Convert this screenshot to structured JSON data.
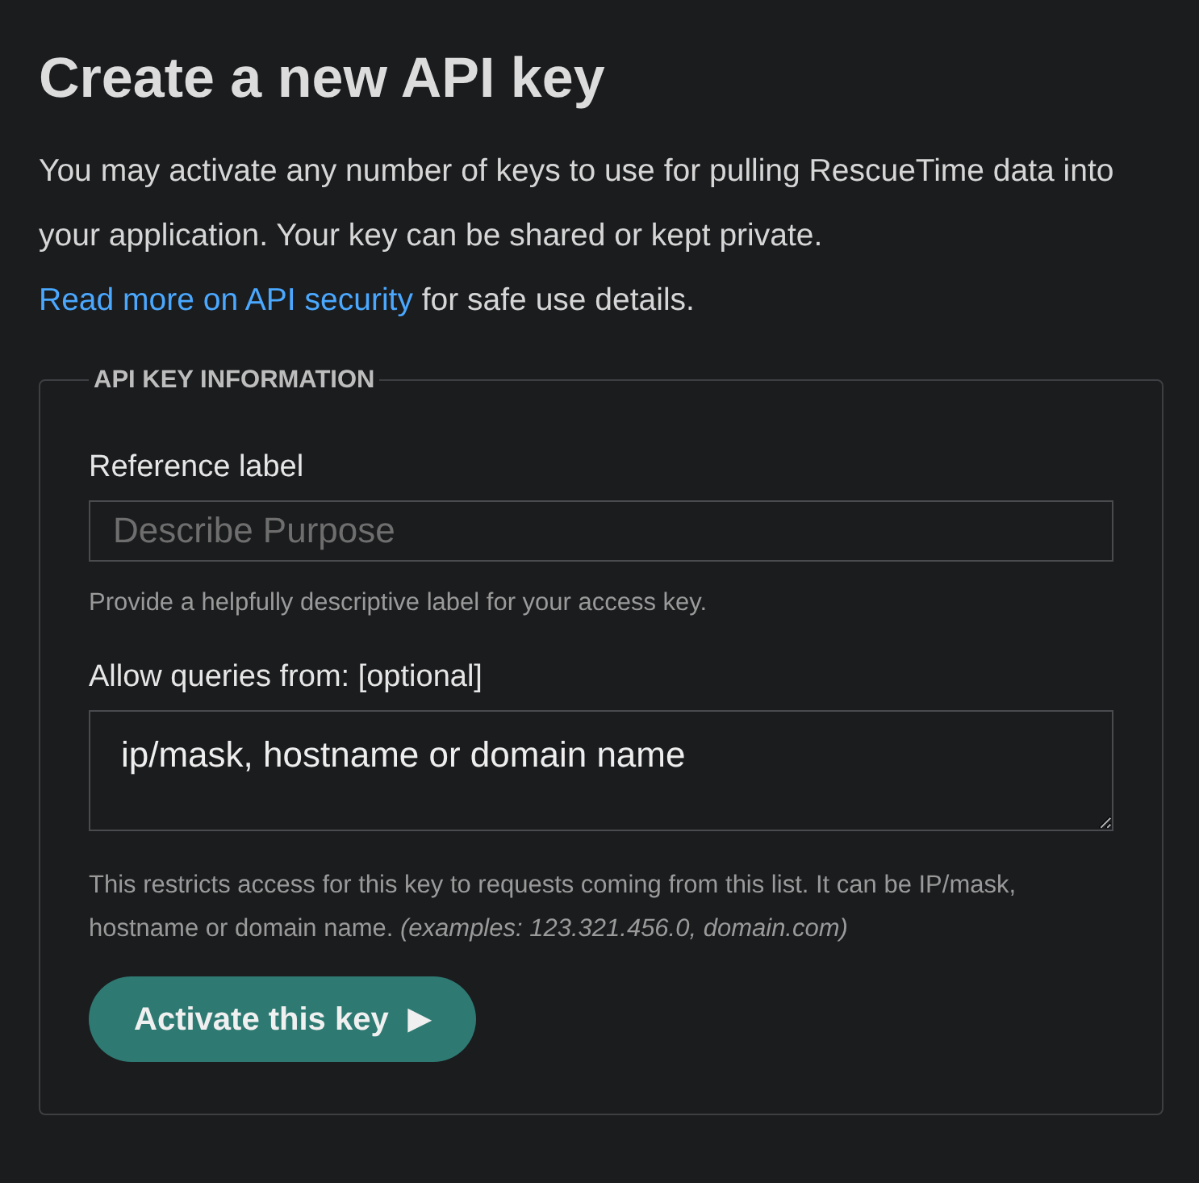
{
  "title": "Create a new API key",
  "intro": {
    "before": "You may activate any number of keys to use for pulling RescueTime data into your application. Your key can be shared or kept private.",
    "link": "Read more on API security",
    "after": "for safe use details."
  },
  "fieldset": {
    "legend": "API KEY INFORMATION",
    "fields": [
      {
        "kind": "input",
        "label": "Reference label",
        "placeholder": "Describe Purpose",
        "help": "Provide a helpfully descriptive label for your access key."
      },
      {
        "kind": "textarea",
        "label": "Allow queries from: [optional]",
        "value": "ip/mask, hostname or domain name",
        "help": "This restricts access for this key to requests coming from this list. It can be IP/mask, hostname or domain name. *(examples: 123.321.456.0, domain.com)*"
      }
    ],
    "button": {
      "label": "Activate this key",
      "icon": "▶"
    }
  }
}
